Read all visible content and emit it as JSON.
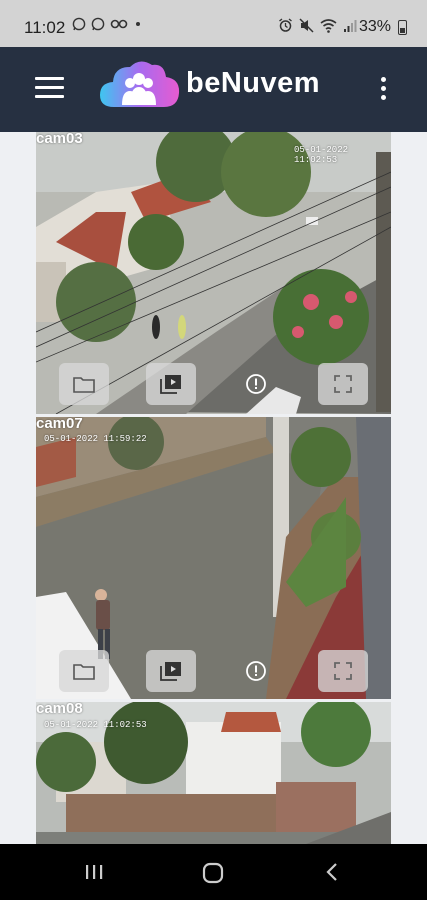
{
  "status_bar": {
    "time": "11:02",
    "app_icons": [
      "whatsapp-icon",
      "whatsapp-icon",
      "oo-icon",
      "dot-icon"
    ],
    "system_icons": [
      "alarm-icon",
      "mute-icon",
      "wifi-icon",
      "signal-icon"
    ],
    "battery_percent": "33%"
  },
  "app_bar": {
    "brand_name": "beNuvem",
    "menu_icon": "hamburger-menu-icon",
    "overflow_icon": "more-vertical-icon",
    "logo_colors": [
      "#3ec6f0",
      "#a86bf0",
      "#e65bd0"
    ],
    "background": "#263041"
  },
  "cameras": [
    {
      "label": "cam03",
      "timestamp": "05-01-2022 11:02:53",
      "controls": [
        "folder-icon",
        "video-library-icon",
        "alert-circle-icon",
        "fullscreen-icon"
      ]
    },
    {
      "label": "cam07",
      "timestamp": "05-01-2022 11:59:22",
      "controls": [
        "folder-icon",
        "video-library-icon",
        "alert-circle-icon",
        "fullscreen-icon"
      ]
    },
    {
      "label": "cam08",
      "timestamp": "05-01-2022 11:02:53",
      "controls": []
    }
  ],
  "nav_bar": {
    "buttons": [
      "recent-apps-icon",
      "home-icon",
      "back-icon"
    ]
  }
}
